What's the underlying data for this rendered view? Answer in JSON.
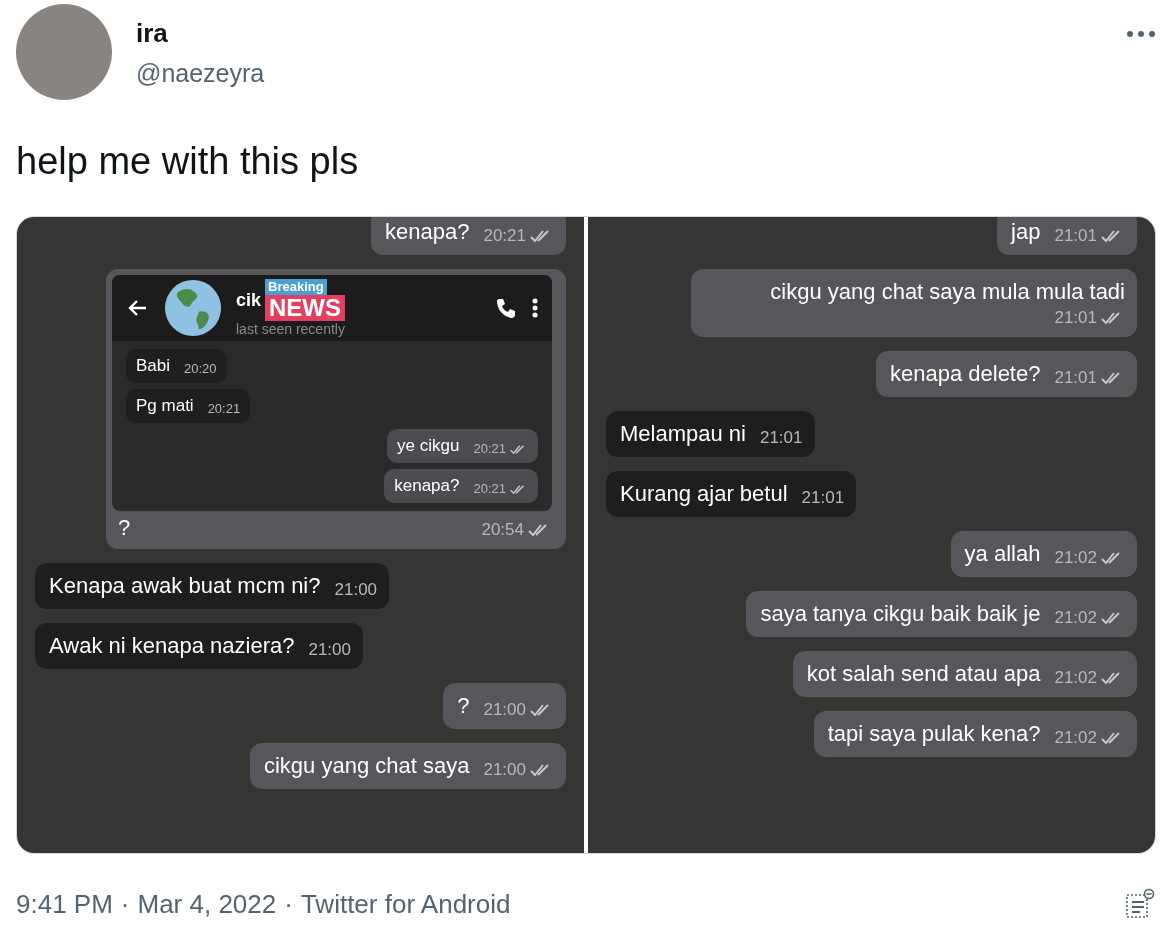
{
  "author": {
    "name": "ira",
    "handle": "@naezeyra"
  },
  "tweet_text": "help me with this pls",
  "panels": [
    {
      "messages": [
        {
          "kind": "out",
          "text": "kenapa?",
          "time": "20:21"
        },
        {
          "kind": "out-screenshot",
          "text": "?",
          "time": "20:54",
          "screenshot": {
            "contact": "cik",
            "sticker_top": "Breaking",
            "sticker_bottom": "NEWS",
            "status": "last seen recently",
            "messages": [
              {
                "kind": "in",
                "text": "Babi",
                "time": "20:20"
              },
              {
                "kind": "in",
                "text": "Pg mati",
                "time": "20:21"
              },
              {
                "kind": "out",
                "text": "ye cikgu",
                "time": "20:21"
              },
              {
                "kind": "out",
                "text": "kenapa?",
                "time": "20:21"
              }
            ]
          }
        },
        {
          "kind": "in",
          "text": "Kenapa awak buat mcm ni?",
          "time": "21:00"
        },
        {
          "kind": "in",
          "text": "Awak ni kenapa naziera?",
          "time": "21:00"
        },
        {
          "kind": "out",
          "text": "?",
          "time": "21:00"
        },
        {
          "kind": "out",
          "text": "cikgu yang chat saya",
          "time": "21:00"
        }
      ]
    },
    {
      "messages": [
        {
          "kind": "out",
          "text": "jap",
          "time": "21:01"
        },
        {
          "kind": "out",
          "text": "cikgu yang chat saya mula mula tadi",
          "time": "21:01"
        },
        {
          "kind": "out",
          "text": "kenapa delete?",
          "time": "21:01"
        },
        {
          "kind": "in",
          "text": "Melampau ni",
          "time": "21:01"
        },
        {
          "kind": "in",
          "text": "Kurang ajar betul",
          "time": "21:01"
        },
        {
          "kind": "out",
          "text": "ya allah",
          "time": "21:02"
        },
        {
          "kind": "out",
          "text": "saya tanya cikgu baik baik je",
          "time": "21:02"
        },
        {
          "kind": "out",
          "text": "kot salah send atau apa",
          "time": "21:02"
        },
        {
          "kind": "out",
          "text": "tapi saya pulak kena?",
          "time": "21:02"
        }
      ]
    }
  ],
  "footer": {
    "separator": "·",
    "parts": [
      "9:41 PM",
      "Mar 4, 2022",
      "Twitter for Android"
    ]
  }
}
